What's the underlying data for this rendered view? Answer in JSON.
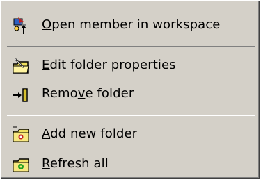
{
  "menu": {
    "items": [
      {
        "label": "Open member in workspace",
        "icon": "open-member-icon"
      },
      {
        "label": "Edit folder properties",
        "icon": "edit-folder-icon"
      },
      {
        "label": "Remove folder",
        "icon": "remove-folder-icon"
      },
      {
        "label": "Add new folder",
        "icon": "add-folder-icon"
      },
      {
        "label": "Refresh all",
        "icon": "refresh-icon"
      }
    ]
  },
  "colors": {
    "menu_bg": "#d4d0c8",
    "text": "#000000",
    "folder_yellow": "#f0e060"
  }
}
